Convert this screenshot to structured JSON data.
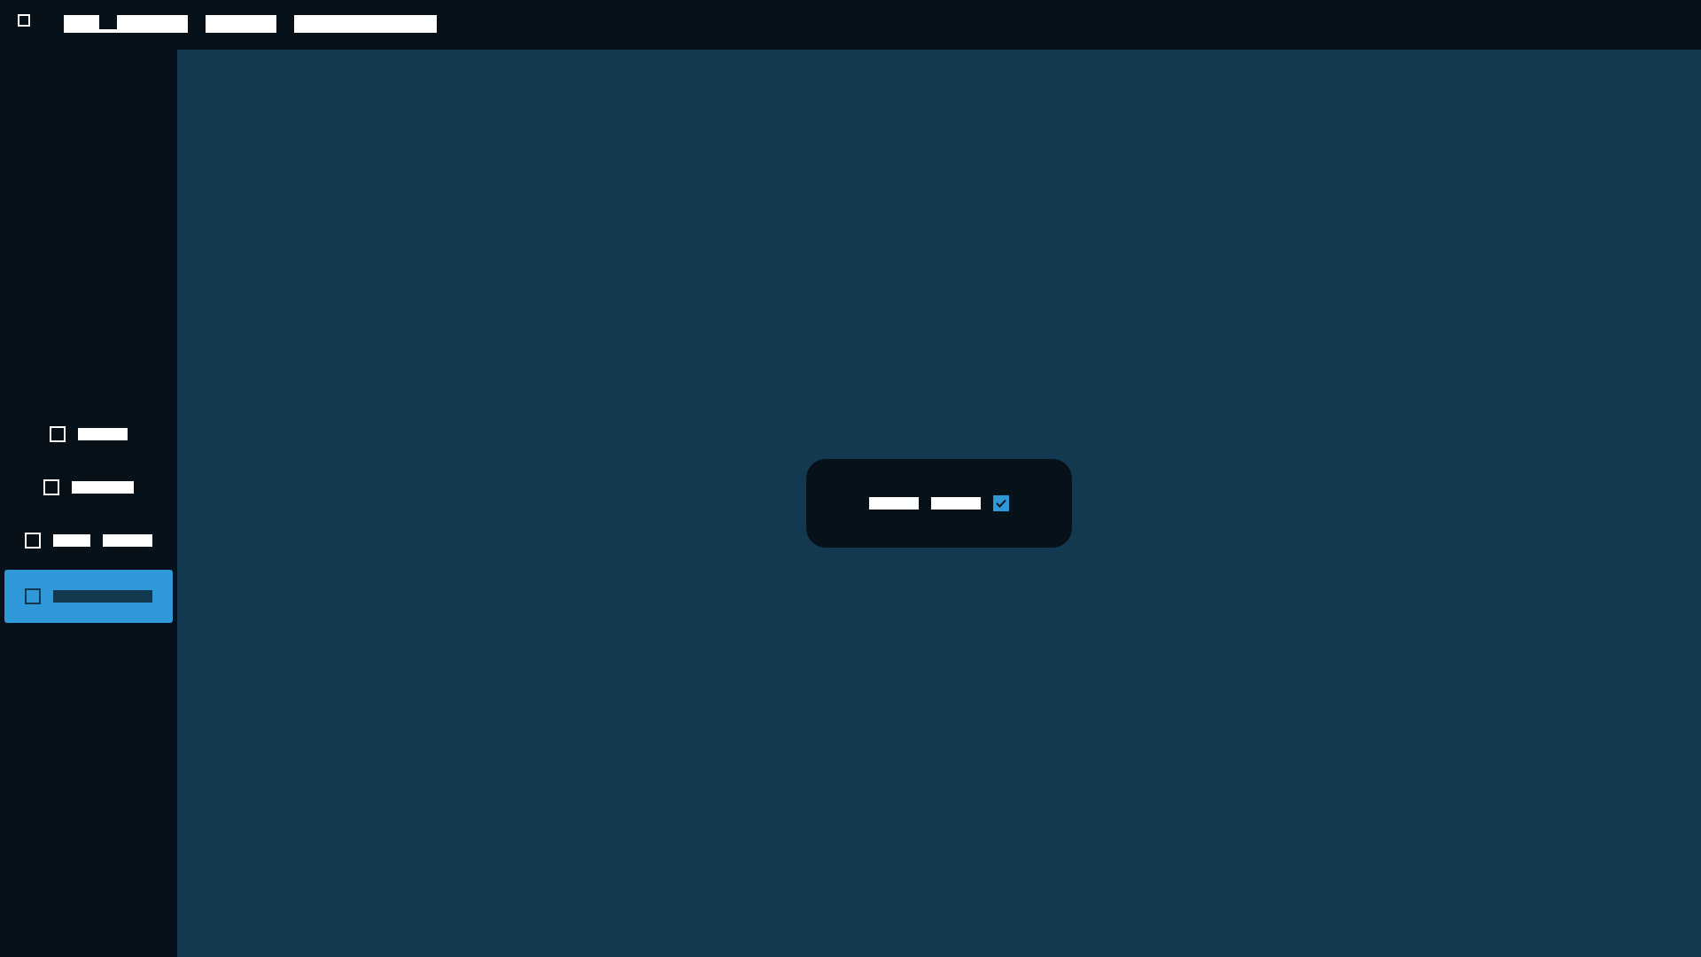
{
  "topbar": {
    "app_icon": "app-icon",
    "menu": [
      "██████████",
      "██████",
      "████████████"
    ]
  },
  "sidebar": {
    "items": [
      {
        "icon": "square-icon",
        "label": "█████",
        "active": false
      },
      {
        "icon": "square-icon",
        "label": "██████",
        "active": false
      },
      {
        "icon": "square-icon",
        "label": "████ █████",
        "active": false
      },
      {
        "icon": "square-icon",
        "label": "██████████",
        "active": true
      }
    ]
  },
  "toast": {
    "word1": "█████",
    "word2": "█████",
    "icon": "checkmark-icon"
  },
  "colors": {
    "background": "#123950",
    "chrome": "#06111a",
    "accent": "#2f98d8",
    "text": "#ffffff"
  }
}
